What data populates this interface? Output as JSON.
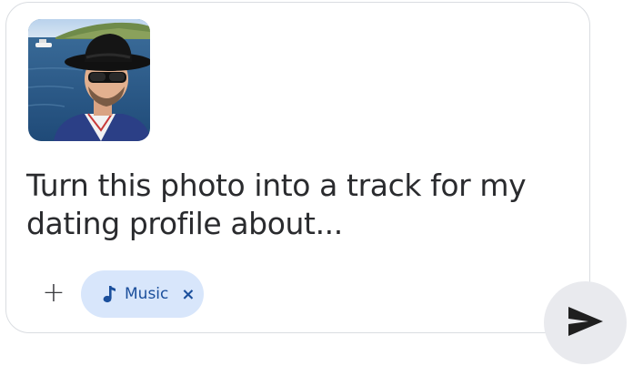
{
  "prompt": {
    "text": "Turn this photo into a track for my dating profile about..."
  },
  "attachment": {
    "alt": "photo-thumbnail"
  },
  "toolbar": {
    "add_label": "+",
    "chip_label": "Music",
    "chip_close": "×",
    "chip_icon": "music-note-icon",
    "send_icon": "send-icon"
  },
  "colors": {
    "chip_bg": "#d8e6fb",
    "chip_text": "#1b4f9c",
    "send_bg": "#e9eaee"
  }
}
